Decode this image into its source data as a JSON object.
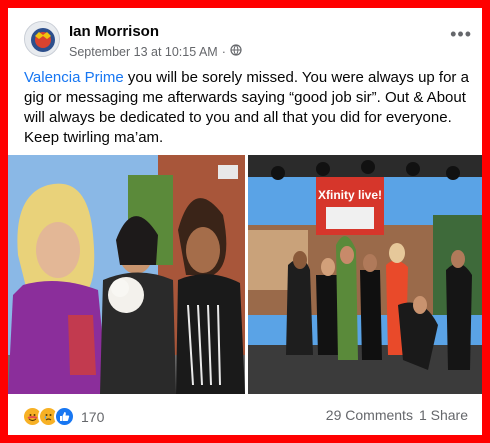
{
  "post": {
    "author": "Ian Morrison",
    "timestamp": "September 13 at 10:15 AM",
    "separator": "·",
    "audience_icon": "globe-icon",
    "more_icon": "more-options-icon",
    "more_label": "•••",
    "mention": "Valencia Prime",
    "body": " you will be sorely missed. You were always up for a gig or messaging me afterwards saying “good job sir”.  Out & About will always be dedicated to you and all that you did for everyone. Keep twirling ma’am."
  },
  "photos": [
    {
      "description": "group-photo-with-dog",
      "color": "#7d3d98"
    },
    {
      "description": "stage-group-photo",
      "sign_text": "Xfinity live!",
      "color": "#3b87d4"
    }
  ],
  "footer": {
    "reactions": [
      "care",
      "sad",
      "like"
    ],
    "reaction_count": "170",
    "comments": "29 Comments",
    "shares": "1 Share"
  },
  "colors": {
    "frame": "#ff0000",
    "link": "#1877f2",
    "muted": "#65676b"
  }
}
